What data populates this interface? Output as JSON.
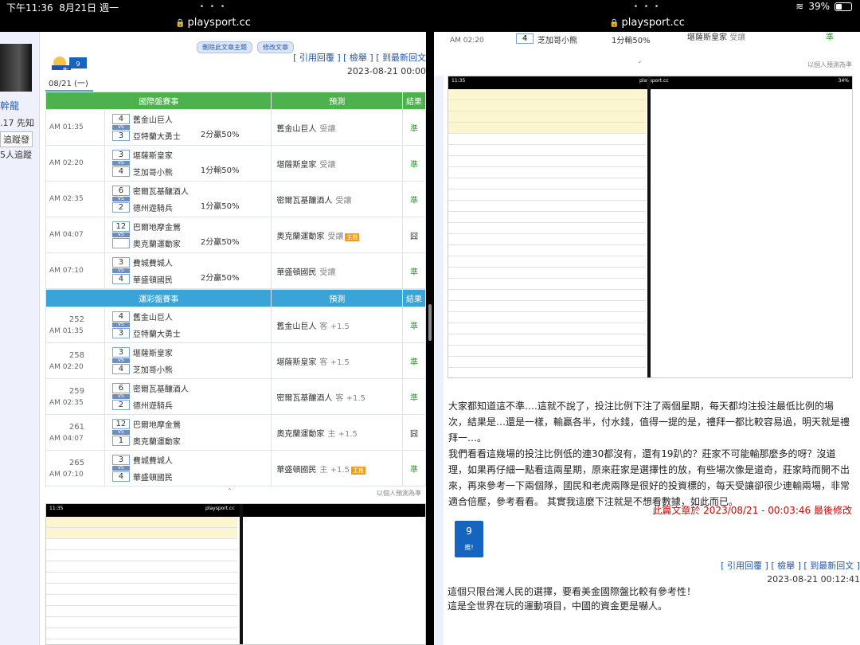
{
  "status": {
    "time": "下午11:36",
    "date": "8月21日 週一",
    "battery": "39%",
    "battery_level": 0.39
  },
  "left": {
    "url": "playsport.cc",
    "sidebar": {
      "name": "幹龍",
      "rank": ".17 先知",
      "follow_button": "追蹤發",
      "follow_count": "5人追蹤"
    },
    "buttons": {
      "delete": "刪除此文章主題",
      "edit": "修改文章"
    },
    "mascot_num": "9",
    "mascot_label": "推!",
    "links": "[ 引用回覆 ] [ 檢舉 ] [ 到最新回文",
    "post_time": "2023-08-21 00:00",
    "date_tab": "08/21 (一)",
    "intl": {
      "header": [
        "國際盤賽事",
        "預測",
        "結果"
      ],
      "rows": [
        {
          "time": "AM 01:35",
          "s1": "4",
          "t1": "舊金山巨人",
          "s2": "3",
          "t2": "亞特蘭大勇士",
          "line": "2分贏50%",
          "pick": "舊金山巨人",
          "pick_sub": "受讓",
          "hot": "",
          "result": "準",
          "res_class": "res-g"
        },
        {
          "time": "AM 02:20",
          "s1": "3",
          "t1": "堪薩斯皇家",
          "s2": "4",
          "t2": "芝加哥小熊",
          "line": "1分輸50%",
          "pick": "堪薩斯皇家",
          "pick_sub": "受讓",
          "hot": "",
          "result": "準",
          "res_class": "res-g"
        },
        {
          "time": "AM 02:35",
          "s1": "6",
          "t1": "密爾瓦基釀酒人",
          "s2": "2",
          "t2": "德州遊騎兵",
          "line": "1分贏50%",
          "pick": "密爾瓦基釀酒人",
          "pick_sub": "受讓",
          "hot": "",
          "result": "準",
          "res_class": "res-g"
        },
        {
          "time": "AM 04:07",
          "s1": "12",
          "t1": "巴爾地摩金鶯",
          "s2": "",
          "t2": "奧克蘭運動家",
          "line": "2分贏50%",
          "pick": "奧克蘭運動家",
          "pick_sub": "受讓",
          "hot": "主推",
          "result": "囧",
          "res_class": "res-d"
        },
        {
          "time": "AM 07:10",
          "s1": "3",
          "t1": "費城費城人",
          "s2": "4",
          "t2": "華盛頓國民",
          "line": "2分贏50%",
          "pick": "華盛頓國民",
          "pick_sub": "受讓",
          "hot": "",
          "result": "準",
          "res_class": "res-g"
        }
      ]
    },
    "lottery": {
      "header": [
        "運彩盤賽事",
        "預測",
        "結果"
      ],
      "rows": [
        {
          "num": "252",
          "time": "AM 01:35",
          "s1": "4",
          "t1": "舊金山巨人",
          "s2": "3",
          "t2": "亞特蘭大勇士",
          "pick": "舊金山巨人",
          "pick_sub": "客 +1.5",
          "hot": "",
          "result": "準",
          "res_class": "res-g"
        },
        {
          "num": "258",
          "time": "AM 02:20",
          "s1": "3",
          "t1": "堪薩斯皇家",
          "s2": "4",
          "t2": "芝加哥小熊",
          "pick": "堪薩斯皇家",
          "pick_sub": "客 +1.5",
          "hot": "",
          "result": "準",
          "res_class": "res-g"
        },
        {
          "num": "259",
          "time": "AM 02:35",
          "s1": "6",
          "t1": "密爾瓦基釀酒人",
          "s2": "2",
          "t2": "德州遊騎兵",
          "pick": "密爾瓦基釀酒人",
          "pick_sub": "客 +1.5",
          "hot": "",
          "result": "準",
          "res_class": "res-g"
        },
        {
          "num": "261",
          "time": "AM 04:07",
          "s1": "12",
          "t1": "巴爾地摩金鶯",
          "s2": "1",
          "t2": "奧克蘭運動家",
          "pick": "奧克蘭運動家",
          "pick_sub": "主 +1.5",
          "hot": "",
          "result": "囧",
          "res_class": "res-d"
        },
        {
          "num": "265",
          "time": "AM 07:10",
          "s1": "3",
          "t1": "費城費城人",
          "s2": "4",
          "t2": "華盛頓國民",
          "pick": "華盛頓國民",
          "pick_sub": "主 +1.5",
          "hot": "主推",
          "result": "準",
          "res_class": "res-g"
        }
      ]
    },
    "footnote": "以個人預測為準"
  },
  "right": {
    "url": "playsport.cc",
    "top_row": {
      "time": "AM 02:20",
      "team": "芝加哥小熊",
      "line": "1分輸50%",
      "pick": "堪薩斯皇家",
      "pick_sub": "受讓",
      "result": "準"
    },
    "footnote": "以個人預測為準",
    "paragraph1": "大家都知道這不準….這就不說了，投注比例下注了兩個星期，每天都均注投注最低比例的場次，結果是…還是一樣，輸贏各半，付水錢，值得一提的是，禮拜一都比較容易過，明天就是禮拜一…。",
    "paragraph2": "我們看看這幾場的投注比例低的連30都沒有，還有19趴的？莊家不可能輸那麼多的呀？沒道理，如果再仔細一點看這兩星期，原來莊家是選擇性的放，有些場次像是道奇，莊家時而開不出來，再來參考一下兩個隊，國民和老虎兩隊是很好的投資標的，每天受讓卻很少連輸兩場，非常適合倍壓，參考看看。 其實我這麼下注就是不想看數據，如此而已。",
    "edit_note": "此篇文章於 2023/08/21 - 00:03:46 最後修改",
    "reply": {
      "mascot_num": "9",
      "mascot_label": "推!",
      "links": "[ 引用回覆 ] [ 檢舉 ] [ 到最新回文 ]",
      "time": "2023-08-21 00:12:41",
      "line1": "這個只限台灣人民的選擇，要看美金國際盤比較有參考性！",
      "line2": "這是全世界在玩的運動項目，中國的資金更是嚇人。"
    }
  }
}
